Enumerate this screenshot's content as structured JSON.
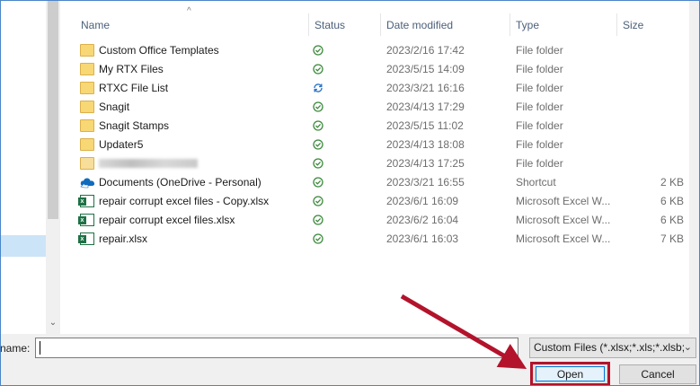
{
  "columns": {
    "name": "Name",
    "status": "Status",
    "date_modified": "Date modified",
    "type": "Type",
    "size": "Size"
  },
  "files": [
    {
      "name": "Custom Office Templates",
      "icon": "folder-icon",
      "status": "synced",
      "date": "2023/2/16 17:42",
      "type": "File folder",
      "size": ""
    },
    {
      "name": "My RTX Files",
      "icon": "folder-icon",
      "status": "synced",
      "date": "2023/5/15 14:09",
      "type": "File folder",
      "size": ""
    },
    {
      "name": "RTXC File List",
      "icon": "folder-icon",
      "status": "syncing",
      "date": "2023/3/21 16:16",
      "type": "File folder",
      "size": ""
    },
    {
      "name": "Snagit",
      "icon": "folder-icon",
      "status": "synced",
      "date": "2023/4/13 17:29",
      "type": "File folder",
      "size": ""
    },
    {
      "name": "Snagit Stamps",
      "icon": "folder-icon",
      "status": "synced",
      "date": "2023/5/15 11:02",
      "type": "File folder",
      "size": ""
    },
    {
      "name": "Updater5",
      "icon": "folder-icon",
      "status": "synced",
      "date": "2023/4/13 18:08",
      "type": "File folder",
      "size": ""
    },
    {
      "name": "",
      "icon": "folder-icon",
      "status": "synced",
      "date": "2023/4/13 17:25",
      "type": "File folder",
      "size": ""
    },
    {
      "name": "Documents (OneDrive - Personal)",
      "icon": "onedrive-shortcut-icon",
      "status": "synced",
      "date": "2023/3/21 16:55",
      "type": "Shortcut",
      "size": "2 KB"
    },
    {
      "name": "repair corrupt excel files - Copy.xlsx",
      "icon": "excel-file-icon",
      "status": "synced",
      "date": "2023/6/1 16:09",
      "type": "Microsoft Excel W...",
      "size": "6 KB"
    },
    {
      "name": "repair corrupt excel files.xlsx",
      "icon": "excel-file-icon",
      "status": "synced",
      "date": "2023/6/2 16:04",
      "type": "Microsoft Excel W...",
      "size": "6 KB"
    },
    {
      "name": "repair.xlsx",
      "icon": "excel-file-icon",
      "status": "synced",
      "date": "2023/6/1 16:03",
      "type": "Microsoft Excel W...",
      "size": "7 KB"
    }
  ],
  "filename_label": "name:",
  "filename_value": "",
  "filter_label": "Custom Files (*.xlsx;*.xls;*.xlsb;",
  "open_label": "Open",
  "cancel_label": "Cancel",
  "colors": {
    "synced_green": "#3c8a3c",
    "syncing_blue": "#2c74c9",
    "highlight_red": "#b3132b",
    "folder_yellow": "#f8d775",
    "excel_green": "#1e7145"
  }
}
